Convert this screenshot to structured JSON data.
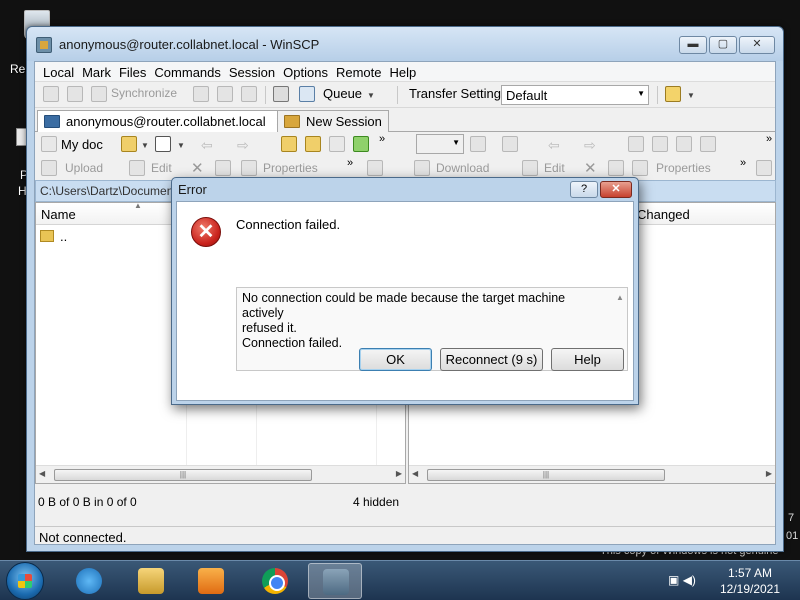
{
  "desktop": {
    "recycle_label": "Re",
    "icon2_line1": "P",
    "icon2_line2": "H",
    "watermark_text": "This copy of Windows is not genuine",
    "side_text_1": "7",
    "side_text_2": "01"
  },
  "window": {
    "title": "anonymous@router.collabnet.local - WinSCP",
    "minimize": "▬",
    "maximize": "▢",
    "close": "✕"
  },
  "menu": [
    "Local",
    "Mark",
    "Files",
    "Commands",
    "Session",
    "Options",
    "Remote",
    "Help"
  ],
  "toolbar": {
    "synchronize": "Synchronize",
    "queue": "Queue",
    "transfer_settings": "Transfer Settings",
    "transfer_value": "Default"
  },
  "tabs": {
    "session": "anonymous@router.collabnet.local",
    "close": "✕",
    "new_session": "New Session"
  },
  "local_pane": {
    "drive": "My doc",
    "upload": "Upload",
    "edit": "Edit",
    "properties": "Properties",
    "path": "C:\\Users\\Dartz\\Documen",
    "col_name": "Name",
    "parent_dir": "..",
    "status_left": "0 B of 0 B in 0 of 0",
    "status_right": "4 hidden"
  },
  "remote_pane": {
    "download": "Download",
    "edit": "Edit",
    "properties": "Properties",
    "col_changed": "Changed"
  },
  "status_bar": "Not connected.",
  "dialog": {
    "title": "Error",
    "help_glyph": "?",
    "close_glyph": "✕",
    "message": "Connection failed.",
    "detail_line1": "No connection could be made because the target machine actively",
    "detail_line2": "refused it.",
    "detail_line3": "Connection failed.",
    "ok": "OK",
    "reconnect": "Reconnect (9 s)",
    "help": "Help"
  },
  "taskbar": {
    "time": "1:57 AM",
    "date": "12/19/2021"
  },
  "colors": {
    "title_bar": "#c6d9ee",
    "error_red": "#c8211b",
    "taskbar": "#2a4666"
  }
}
